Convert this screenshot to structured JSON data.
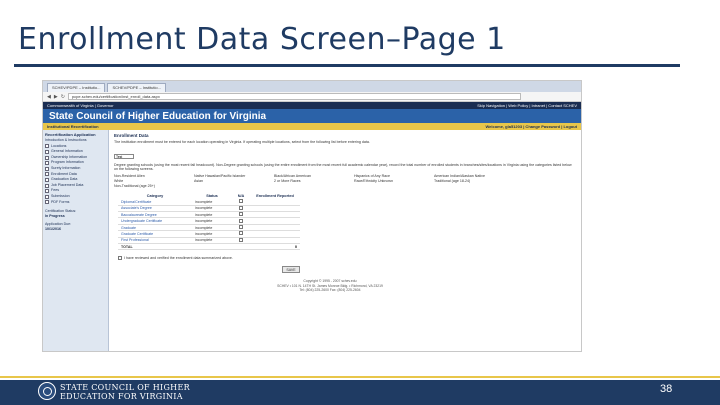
{
  "slide": {
    "title": "Enrollment Data Screen–Page 1",
    "page_number": "38",
    "logo_line1": "STATE COUNCIL OF HIGHER",
    "logo_line2": "EDUCATION FOR VIRGINIA"
  },
  "browser": {
    "tabs": [
      "SCHEV/PDPE – Institutio...",
      "SCHEV/PDPE – Institutio..."
    ],
    "url": "pcpe.schev.edu/certification/inst_enroll_data.aspx",
    "icons": [
      "back-icon",
      "forward-icon",
      "reload-icon"
    ]
  },
  "site": {
    "top_left": "Commonwealth of Virginia | Governor",
    "top_right": "Skip Navigation | Web Policy | Intranet | Contact SCHEV",
    "banner": "State Council of Higher Education for Virginia",
    "section": "Institutional Recertification",
    "user_links": "Welcome, gla51203 | Change Password | Logout"
  },
  "leftnav": {
    "header": "Recertification Application",
    "items": [
      "Introduction & Instructions",
      "Locations",
      "General Information",
      "Ownership Information",
      "Program Information",
      "Surety Information",
      "Enrollment Data",
      "Graduation Data",
      "Job Placement Data",
      "Fees",
      "Submission",
      "PDF Forms"
    ],
    "status_label": "Certification Status:",
    "status_value": "In Progress",
    "due_label": "Application Due:",
    "due_value": "10/1/2016"
  },
  "content": {
    "heading": "Enrollment Data",
    "instruction": "The institution enrollment must be entered for each location operating in Virginia. If operating multiple locations, select from the following list before entering data.",
    "select_value": "Test",
    "degree_note": "Degree granting schools (using the most recent fall headcount). Non-Degree granting schools (using the entire enrollment from the most recent full academic calendar year), record the total number of enrolled students in branches/sites/locations in Virginia using the categories listed below on the following screens.",
    "races": [
      "Non-Resident Alien",
      "Native Hawaiian/Pacific Islander",
      "Black/African American",
      "Hispanics of Any Race",
      "American Indian/Alaskan Native",
      "White",
      "Asian",
      "2 or More Races",
      "Race/Ethnicity Unknown",
      "Traditional (age 18-24)",
      "Non-Traditional (age 25+)"
    ],
    "columns": [
      "Category",
      "Status",
      "N/A",
      "Enrollment Reported"
    ],
    "rows": [
      {
        "category": "Diploma/Certificate",
        "status": "incomplete"
      },
      {
        "category": "Associate's Degree",
        "status": "incomplete"
      },
      {
        "category": "Baccalaureate Degree",
        "status": "incomplete"
      },
      {
        "category": "Undergraduate Certificate",
        "status": "incomplete"
      },
      {
        "category": "Graduate",
        "status": "incomplete"
      },
      {
        "category": "Graduate Certificate",
        "status": "incomplete"
      },
      {
        "category": "First Professional",
        "status": "incomplete"
      }
    ],
    "total_label": "TOTAL",
    "total_value": "0",
    "certify": "I have reviewed and verified the enrollment data summarized above.",
    "save_label": "SAVE",
    "footer1": "Copyright © 1995 - 2007 schev.edu",
    "footer2": "SCHEV • 101 N. 14TH St. James Monroe Bldg. • Richmond, VA 23219",
    "footer3": "Tel: (804) 225-2600 Fax: (804) 225-2604"
  }
}
